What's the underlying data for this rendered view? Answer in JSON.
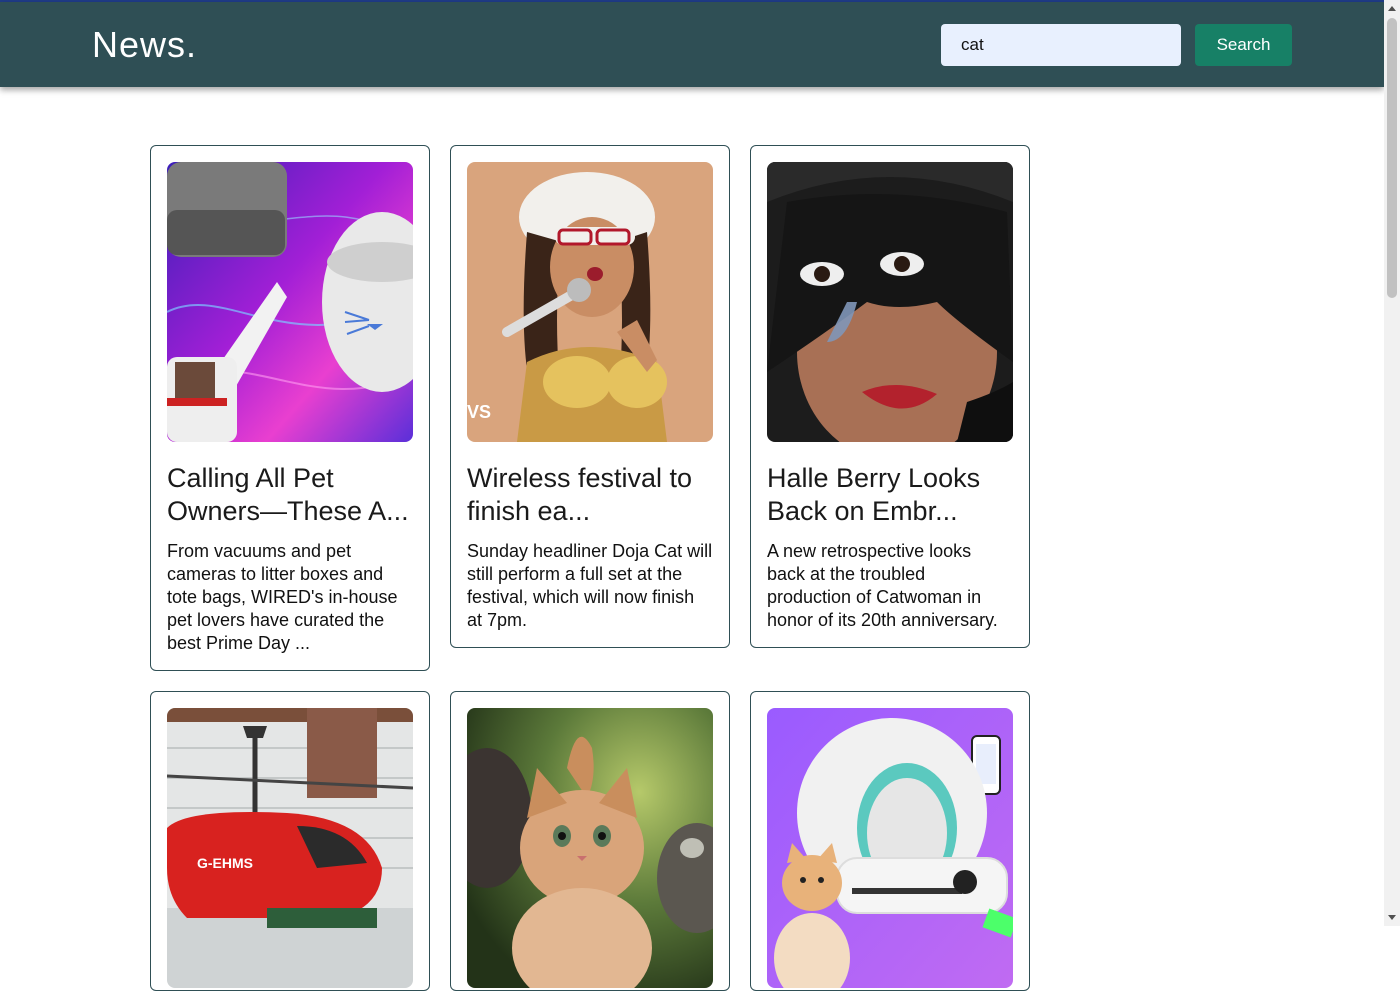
{
  "header": {
    "logo": "News.",
    "search_value": "cat",
    "search_button": "Search"
  },
  "articles": [
    {
      "title": "Calling All Pet Owners—These A...",
      "description": "From vacuums and pet cameras to litter boxes and tote bags, WIRED's in-house pet lovers have curated the best Prime Day ..."
    },
    {
      "title": "Wireless festival to finish ea...",
      "description": "Sunday headliner Doja Cat will still perform a full set at the festival, which will now finish at 7pm."
    },
    {
      "title": "Halle Berry Looks Back on Embr...",
      "description": "A new retrospective looks back at the troubled production of Catwoman in honor of its 20th anniversary."
    },
    {
      "title": "",
      "description": ""
    },
    {
      "title": "",
      "description": ""
    },
    {
      "title": "",
      "description": ""
    }
  ],
  "colors": {
    "header_bg": "#2f4f55",
    "search_button_bg": "#178066",
    "input_bg": "#e8f0fe",
    "card_border": "#2f4f55"
  }
}
